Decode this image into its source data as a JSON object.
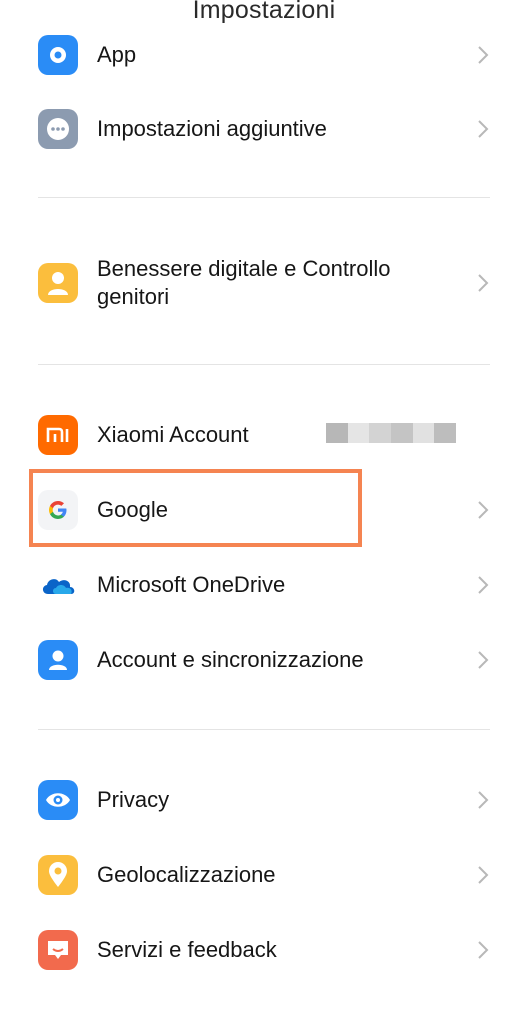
{
  "header": {
    "title": "Impostazioni"
  },
  "items": [
    {
      "label": "App",
      "icon": "gear-icon",
      "color": "#2a8cf6"
    },
    {
      "label": "Impostazioni aggiuntive",
      "icon": "more-dots-icon",
      "color": "#8c9bb0"
    },
    {
      "label": "Benessere digitale e Controllo genitori",
      "icon": "wellbeing-icon",
      "color": "#fbbe3d"
    },
    {
      "label": "Xiaomi Account",
      "icon": "mi-logo-icon",
      "color": "#ff6a00"
    },
    {
      "label": "Google",
      "icon": "google-logo-icon",
      "color": "#f3f4f6"
    },
    {
      "label": "Microsoft OneDrive",
      "icon": "onedrive-cloud-icon",
      "color": "#0a64c8"
    },
    {
      "label": "Account e sincronizzazione",
      "icon": "account-icon",
      "color": "#2a8cf6"
    },
    {
      "label": "Privacy",
      "icon": "eye-icon",
      "color": "#2a8cf6"
    },
    {
      "label": "Geolocalizzazione",
      "icon": "location-pin-icon",
      "color": "#fbbe3d"
    },
    {
      "label": "Servizi e feedback",
      "icon": "feedback-icon",
      "color": "#f26a4d"
    }
  ],
  "highlight": {
    "target": "Google",
    "color": "#f58451"
  }
}
